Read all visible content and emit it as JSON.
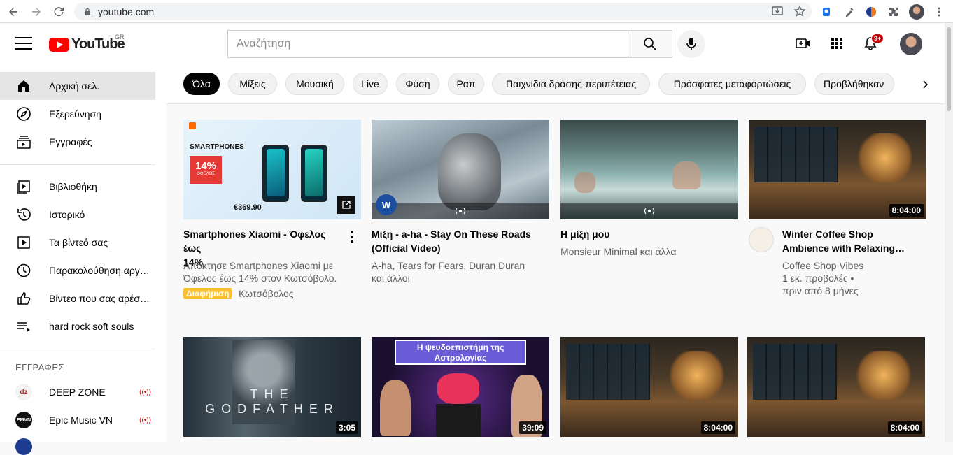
{
  "browser": {
    "url": "youtube.com"
  },
  "masthead": {
    "logo_text": "YouTube",
    "country_code": "GR",
    "search_placeholder": "Αναζήτηση",
    "notification_count": "9+"
  },
  "sidebar": {
    "main": [
      {
        "label": "Αρχική σελ.",
        "icon": "home-icon",
        "active": true
      },
      {
        "label": "Εξερεύνηση",
        "icon": "compass-icon"
      },
      {
        "label": "Εγγραφές",
        "icon": "subscriptions-icon"
      }
    ],
    "library": [
      {
        "label": "Βιβλιοθήκη",
        "icon": "library-icon"
      },
      {
        "label": "Ιστορικό",
        "icon": "history-icon"
      },
      {
        "label": "Τα βίντεό σας",
        "icon": "your-videos-icon"
      },
      {
        "label": "Παρακολούθηση αργότερα",
        "icon": "watch-later-icon"
      },
      {
        "label": "Βίντεο που σας αρέσουν",
        "icon": "thumbs-up-icon"
      },
      {
        "label": "hard rock soft souls",
        "icon": "playlist-icon"
      }
    ],
    "subscriptions_heading": "ΕΓΓΡΑΦΕΣ",
    "subscriptions": [
      {
        "label": "DEEP ZONE",
        "avatar_text": "dz",
        "live": true
      },
      {
        "label": "Epic Music VN",
        "avatar_text": "EMVN",
        "live": true
      }
    ]
  },
  "chips": [
    "Όλα",
    "Μίξεις",
    "Μουσική",
    "Live",
    "Φύση",
    "Ραπ",
    "Παιχνίδια δράσης-περιπέτειας",
    "Πρόσφατες μεταφορτώσεις",
    "Προβλήθηκαν"
  ],
  "videos": [
    {
      "title_line1": "Smartphones Xiaomi - Όφελος έως",
      "title_line2": "14%",
      "meta1": "Απόκτησε Smartphones Xiaomi με",
      "meta2": "Όφελος έως 14% στον Κωτσόβολο.",
      "ad_label": "Διαφήμιση",
      "advertiser": "Κωτσόβολος",
      "thumb_heading": "SMARTPHONES",
      "thumb_badge": "14%",
      "thumb_badge_sub": "ΟΦΕΛΟΣ",
      "thumb_price": "€369.90"
    },
    {
      "title_line1": "Μίξη - a-ha - Stay On These Roads",
      "title_line2": "(Official Video)",
      "meta1": "A-ha, Tears for Fears, Duran Duran",
      "meta2": "και άλλοι"
    },
    {
      "title_line1": "Η μίξη μου",
      "meta1": "Monsieur Minimal και άλλα"
    },
    {
      "title_line1": "Winter Coffee Shop",
      "title_line2": "Ambience with Relaxing…",
      "meta1": "Coffee Shop Vibes",
      "meta2": "1 εκ. προβολές •",
      "meta3": "πριν από 8 μήνες",
      "duration": "8:04:00"
    },
    {
      "duration": "3:05",
      "thumb_text": "THE GODFATHER"
    },
    {
      "duration": "39:09",
      "thumb_text": "Η ψευδοεπιστήμη της Αστρολογίας"
    },
    {
      "duration": "8:04:00"
    },
    {
      "duration": "8:04:00"
    }
  ],
  "colors": {
    "accent": "#ff0000",
    "ad_badge": "#fbc02d",
    "chip_selected": "#030303"
  }
}
